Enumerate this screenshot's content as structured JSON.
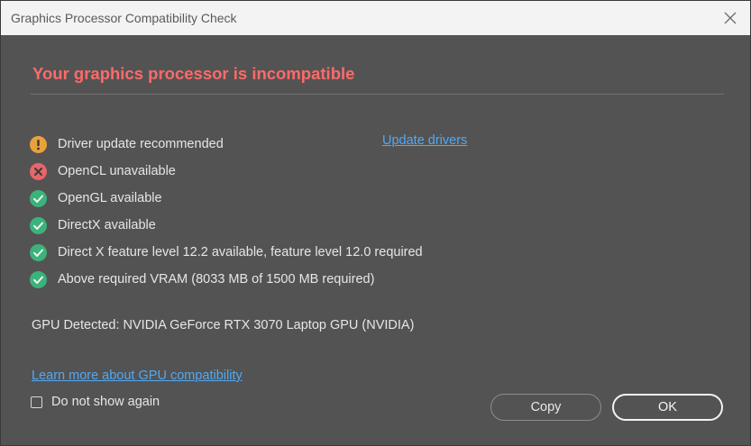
{
  "window": {
    "title": "Graphics Processor Compatibility Check",
    "close_icon": "close-icon"
  },
  "main": {
    "heading": "Your graphics processor is incompatible",
    "heading_color": "#ff6a6a",
    "checks": [
      {
        "label": "Driver update recommended",
        "status": "warning",
        "icon": "warning-icon"
      },
      {
        "label": "OpenCL unavailable",
        "status": "error",
        "icon": "error-icon"
      },
      {
        "label": "OpenGL available",
        "status": "ok",
        "icon": "check-icon"
      },
      {
        "label": "DirectX available",
        "status": "ok",
        "icon": "check-icon"
      },
      {
        "label": "Direct X feature level 12.2 available, feature level 12.0 required",
        "status": "ok",
        "icon": "check-icon"
      },
      {
        "label": "Above required VRAM (8033 MB of 1500 MB required)",
        "status": "ok",
        "icon": "check-icon"
      }
    ],
    "update_drivers_link": "Update drivers",
    "gpu_detected": "GPU Detected: NVIDIA GeForce RTX 3070 Laptop GPU (NVIDIA)",
    "learn_more_link": "Learn more about GPU compatibility",
    "do_not_show_again": {
      "label": "Do not show again",
      "checked": false
    }
  },
  "footer": {
    "copy_label": "Copy",
    "ok_label": "OK"
  },
  "colors": {
    "background": "#535353",
    "warning": "#e8a23c",
    "error": "#e8656b",
    "ok": "#3bb37a",
    "link": "#53a8f2"
  }
}
